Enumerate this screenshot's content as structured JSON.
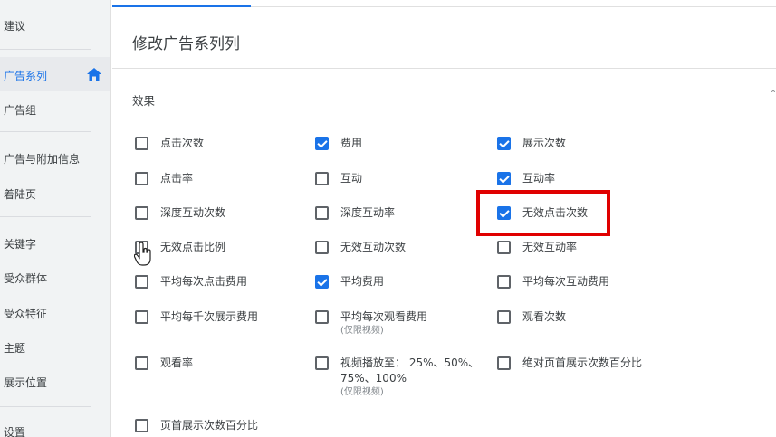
{
  "sidebar": {
    "items": [
      {
        "label": "建议",
        "active": false
      },
      {
        "label": "广告系列",
        "active": true
      },
      {
        "label": "广告组",
        "active": false
      },
      {
        "label": "广告与附加信息",
        "active": false
      },
      {
        "label": "着陆页",
        "active": false
      },
      {
        "label": "关键字",
        "active": false
      },
      {
        "label": "受众群体",
        "active": false
      },
      {
        "label": "受众特征",
        "active": false
      },
      {
        "label": "主题",
        "active": false
      },
      {
        "label": "展示位置",
        "active": false
      },
      {
        "label": "设置",
        "active": false
      }
    ],
    "active_icon": "home-icon",
    "accent_color": "#1a73e8"
  },
  "main": {
    "title": "修改广告系列列",
    "section_title": "效果",
    "options": [
      {
        "label": "点击次数",
        "checked": false
      },
      {
        "label": "费用",
        "checked": true
      },
      {
        "label": "展示次数",
        "checked": true
      },
      {
        "label": "点击率",
        "checked": false
      },
      {
        "label": "互动",
        "checked": false
      },
      {
        "label": "互动率",
        "checked": true
      },
      {
        "label": "深度互动次数",
        "checked": false
      },
      {
        "label": "深度互动率",
        "checked": false
      },
      {
        "label": "无效点击次数",
        "checked": true,
        "highlighted": true
      },
      {
        "label": "无效点击比例",
        "checked": false
      },
      {
        "label": "无效互动次数",
        "checked": false
      },
      {
        "label": "无效互动率",
        "checked": false
      },
      {
        "label": "平均每次点击费用",
        "checked": false
      },
      {
        "label": "平均费用",
        "checked": true
      },
      {
        "label": "平均每次互动费用",
        "checked": false
      },
      {
        "label": "平均每千次展示费用",
        "checked": false
      },
      {
        "label": "平均每次观看费用",
        "sublabel": "(仅限视频)",
        "checked": false
      },
      {
        "label": "观看次数",
        "checked": false
      },
      {
        "label": "观看率",
        "checked": false
      },
      {
        "label": "视频播放至： 25%、50%、",
        "label2": "75%、100%",
        "sublabel": "(仅限视频)",
        "checked": false
      },
      {
        "label": "绝对页首展示次数百分比",
        "checked": false
      },
      {
        "label": "页首展示次数百分比",
        "checked": false
      }
    ],
    "highlight_color": "#e00000"
  }
}
